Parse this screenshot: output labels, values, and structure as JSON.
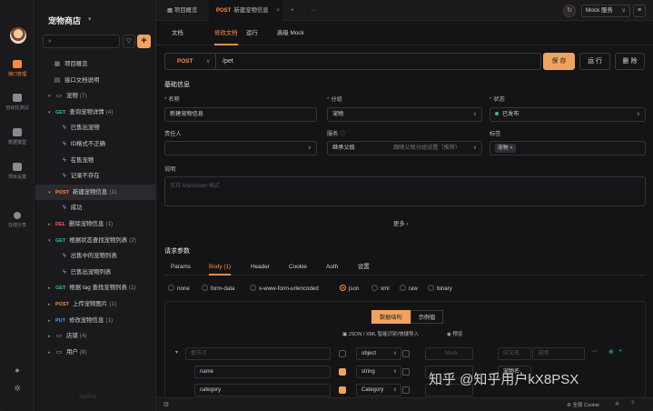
{
  "rail": {
    "items": [
      "接口管理",
      "自动化测试",
      "数据模型",
      "项目设置",
      "在线分享"
    ]
  },
  "sidebar": {
    "project_name": "宠物商店",
    "tree": [
      {
        "icon": "▦",
        "label": "项目概览"
      },
      {
        "icon": "▤",
        "label": "接口文档说明"
      },
      {
        "caret": "▾",
        "icon": "▭",
        "label": "宠物",
        "count": "(7)"
      },
      {
        "caret": "▾",
        "method": "GET",
        "mclass": "get",
        "label": "查询宠物详情",
        "count": "(4)"
      },
      {
        "bolt": true,
        "label": "已售出宠物"
      },
      {
        "bolt": true,
        "label": "ID格式不正确"
      },
      {
        "bolt": true,
        "label": "在售宠物"
      },
      {
        "bolt": true,
        "label": "记录不存在"
      },
      {
        "caret": "▾",
        "method": "POST",
        "mclass": "post",
        "label": "新建宠物信息",
        "count": "(1)",
        "selected": true
      },
      {
        "bolt": true,
        "label": "成功"
      },
      {
        "caret": "▸",
        "method": "DEL",
        "mclass": "del",
        "label": "删除宠物信息",
        "count": "(1)"
      },
      {
        "caret": "▾",
        "method": "GET",
        "mclass": "get",
        "label": "根据状态查找宠物列表",
        "count": "(2)"
      },
      {
        "bolt": true,
        "label": "出售中的宠物列表"
      },
      {
        "bolt": true,
        "label": "已售出宠物列表"
      },
      {
        "caret": "▸",
        "method": "GET",
        "mclass": "get",
        "label": "根据 tag 查找宠物列表",
        "count": "(1)"
      },
      {
        "caret": "▸",
        "method": "POST",
        "mclass": "post",
        "label": "上传宠物图片",
        "count": "(1)"
      },
      {
        "caret": "▸",
        "method": "PUT",
        "mclass": "put",
        "label": "修改宠物信息",
        "count": "(1)"
      },
      {
        "caret": "▸",
        "icon": "▭",
        "label": "店铺",
        "count": "(4)"
      },
      {
        "caret": "▸",
        "icon": "▭",
        "label": "用户",
        "count": "(8)"
      }
    ],
    "brand": "Apifox"
  },
  "topbar": {
    "tab1": "项目概览",
    "tab2_method": "POST",
    "tab2_label": "新建宠物信息",
    "close": "×",
    "plus": "+",
    "more": "···",
    "mock": "Mock 服务",
    "mock_chev": "∨",
    "menu": "≡"
  },
  "subtabs": [
    "文档",
    "修改文档",
    "运行",
    "高级 Mock"
  ],
  "request": {
    "method": "POST",
    "path": "/pet",
    "save": "保 存",
    "run": "运 行",
    "delete": "删 除"
  },
  "basic": {
    "title": "基础信息",
    "name_label": "名称",
    "name_value": "新建宠物信息",
    "group_label": "分组",
    "group_value": "宠物",
    "status_label": "状态",
    "status_value": "已发布",
    "owner_label": "责任人",
    "service_label": "服务",
    "service_value": "继承父级",
    "service_hint": "跟随父级分组设置（推荐）",
    "tags_label": "标签",
    "tag_value": "宠物",
    "desc_label": "说明",
    "desc_placeholder": "支持 Markdown 格式",
    "more": "更多"
  },
  "params": {
    "title": "请求参数",
    "tabs": [
      "Params",
      "Body (1)",
      "Header",
      "Cookie",
      "Auth",
      "设置"
    ],
    "body_types": [
      "none",
      "form-data",
      "x-www-form-urlencoded",
      "json",
      "xml",
      "raw",
      "binary"
    ],
    "mode_structure": "数据结构",
    "mode_example": "示例值",
    "json_import": "JSON / XML 智能识别/快捷导入",
    "preview": "预览",
    "rows": [
      {
        "name": "",
        "name_ph": "根节点",
        "type": "object",
        "mock_ph": "Mock",
        "cn_ph": "中文名",
        "desc_ph": "说明"
      },
      {
        "name": "name",
        "type": "string",
        "cn": "宠物名"
      },
      {
        "name": "category",
        "type": "Category"
      }
    ]
  },
  "statusbar": {
    "cookie": "全局 Cookie"
  },
  "watermark": "知乎 @知乎用户kX8PSX"
}
